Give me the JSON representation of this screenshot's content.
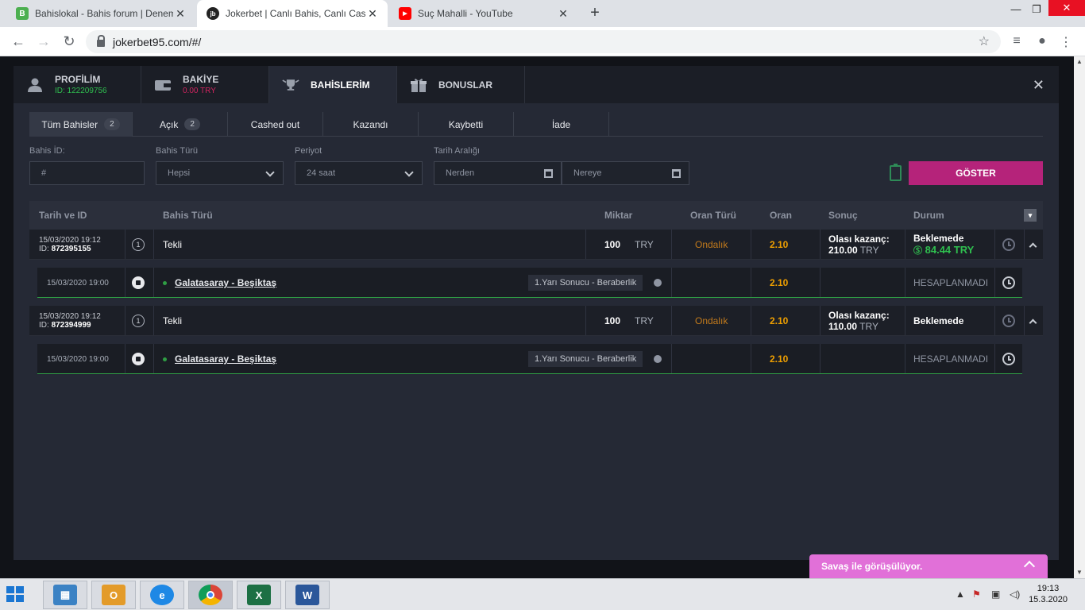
{
  "browser": {
    "tabs": [
      {
        "title": "Bahislokal - Bahis forum | Denem",
        "favicon": "B",
        "favcolor": "#4caf50"
      },
      {
        "title": "Jokerbet | Canlı Bahis, Canlı Casin",
        "favicon": "jb",
        "favcolor": "#7b1fa2"
      },
      {
        "title": "Suç Mahalli - YouTube",
        "favicon": "▶",
        "favcolor": "#ff0000"
      }
    ],
    "url": "jokerbet95.com/#/"
  },
  "modal": {
    "tabs": [
      {
        "label": "PROFİLİM",
        "sub": "ID: 122209756",
        "subcolor": "#2fbf4f"
      },
      {
        "label": "BAKİYE",
        "sub": "0.00 TRY",
        "subcolor": "#d0245f"
      },
      {
        "label": "BAHİSLERİM",
        "sub": ""
      },
      {
        "label": "BONUSLAR",
        "sub": ""
      }
    ],
    "close": "✕"
  },
  "filters": {
    "tabs": [
      {
        "label": "Tüm Bahisler",
        "count": "2"
      },
      {
        "label": "Açık",
        "count": "2"
      },
      {
        "label": "Cashed out",
        "count": ""
      },
      {
        "label": "Kazandı",
        "count": ""
      },
      {
        "label": "Kaybetti",
        "count": ""
      },
      {
        "label": "İade",
        "count": ""
      }
    ],
    "bet_id_label": "Bahis İD:",
    "bet_id_placeholder": "#",
    "bet_type_label": "Bahis Türü",
    "bet_type_value": "Hepsi",
    "period_label": "Periyot",
    "period_value": "24 saat",
    "date_range_label": "Tarih Aralığı",
    "from_placeholder": "Nerden",
    "to_placeholder": "Nereye",
    "show_button": "GÖSTER"
  },
  "table": {
    "headers": {
      "date_id": "Tarih ve ID",
      "bet_type": "Bahis Türü",
      "amount": "Miktar",
      "odds_type": "Oran Türü",
      "odds": "Oran",
      "result": "Sonuç",
      "status": "Durum"
    },
    "bets": [
      {
        "date": "15/03/2020 19:12",
        "id_label": "ID:",
        "id": "872395155",
        "num": "1",
        "type": "Tekli",
        "amount": "100",
        "currency": "TRY",
        "odds_type": "Ondalık",
        "odds": "2.10",
        "possible_label": "Olası kazanç:",
        "possible_value": "210.00",
        "possible_currency": "TRY",
        "status": "Beklemede",
        "cashout": "84.44 TRY",
        "selection": {
          "date": "15/03/2020 19:00",
          "match": "Galatasaray - Beşiktaş",
          "market": "1.Yarı Sonucu - Beraberlik",
          "odds": "2.10",
          "status": "HESAPLANMADI"
        }
      },
      {
        "date": "15/03/2020 19:12",
        "id_label": "ID:",
        "id": "872394999",
        "num": "1",
        "type": "Tekli",
        "amount": "100",
        "currency": "TRY",
        "odds_type": "Ondalık",
        "odds": "2.10",
        "possible_label": "Olası kazanç:",
        "possible_value": "110.00",
        "possible_currency": "TRY",
        "status": "Beklemede",
        "cashout": "",
        "selection": {
          "date": "15/03/2020 19:00",
          "match": "Galatasaray - Beşiktaş",
          "market": "1.Yarı Sonucu - Beraberlik",
          "odds": "2.10",
          "status": "HESAPLANMADI"
        }
      }
    ]
  },
  "chat": {
    "text": "Savaş ile görüşülüyor."
  },
  "taskbar": {
    "time": "19:13",
    "date": "15.3.2020"
  },
  "colors": {
    "accent": "#b5237a",
    "odds": "#f0a000",
    "odds_type": "#c27a1c",
    "green": "#2fbf4f"
  }
}
